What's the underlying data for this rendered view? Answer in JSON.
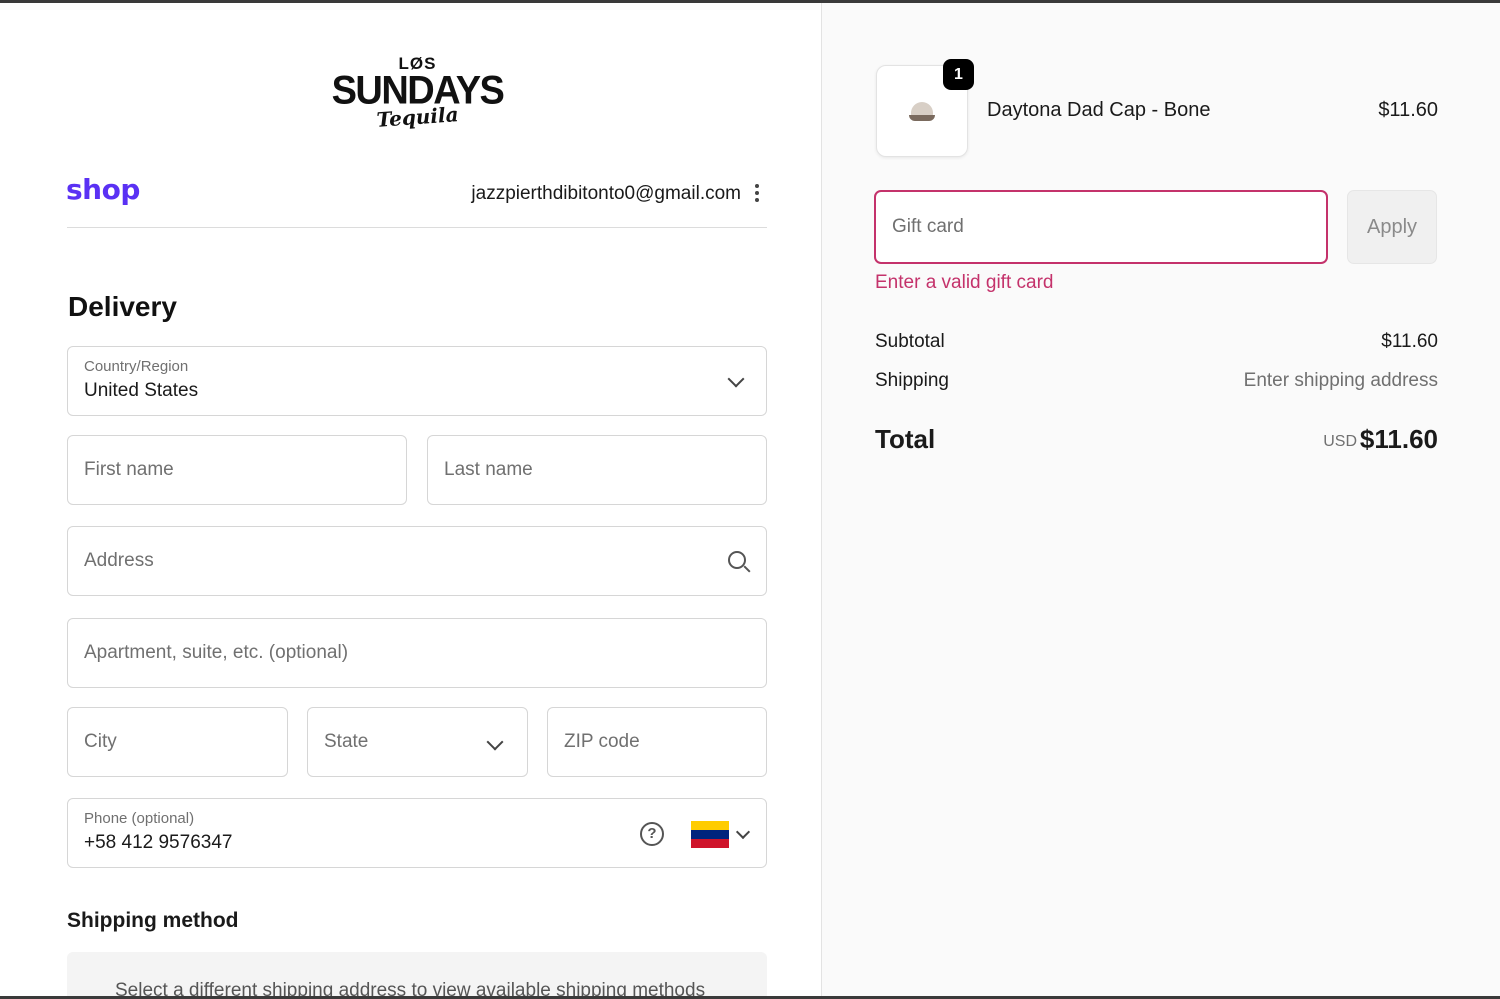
{
  "brand": {
    "logo_top": "LØS",
    "logo_main": "SUNDAYS",
    "logo_sub": "Tequila",
    "shop_label": "shop",
    "shop_color": "#5a31f4"
  },
  "account": {
    "email": "jazzpierthdibitonto0@gmail.com"
  },
  "delivery": {
    "title": "Delivery",
    "country_label": "Country/Region",
    "country_value": "United States",
    "first_name_placeholder": "First name",
    "last_name_placeholder": "Last name",
    "address_placeholder": "Address",
    "apartment_placeholder": "Apartment, suite, etc. (optional)",
    "city_placeholder": "City",
    "state_placeholder": "State",
    "zip_placeholder": "ZIP code",
    "phone_label": "Phone (optional)",
    "phone_value": "+58 412 9576347",
    "help_glyph": "?"
  },
  "shipping_method": {
    "title": "Shipping method",
    "message": "Select a different shipping address to view available shipping methods"
  },
  "order": {
    "item": {
      "quantity": "1",
      "name": "Daytona Dad Cap - Bone",
      "price": "$11.60"
    },
    "gift_card_placeholder": "Gift card",
    "apply_label": "Apply",
    "gift_error": "Enter a valid gift card",
    "subtotal_label": "Subtotal",
    "subtotal_value": "$11.60",
    "shipping_label": "Shipping",
    "shipping_value": "Enter shipping address",
    "total_label": "Total",
    "total_currency": "USD",
    "total_value": "$11.60",
    "error_color": "#c4326b"
  }
}
